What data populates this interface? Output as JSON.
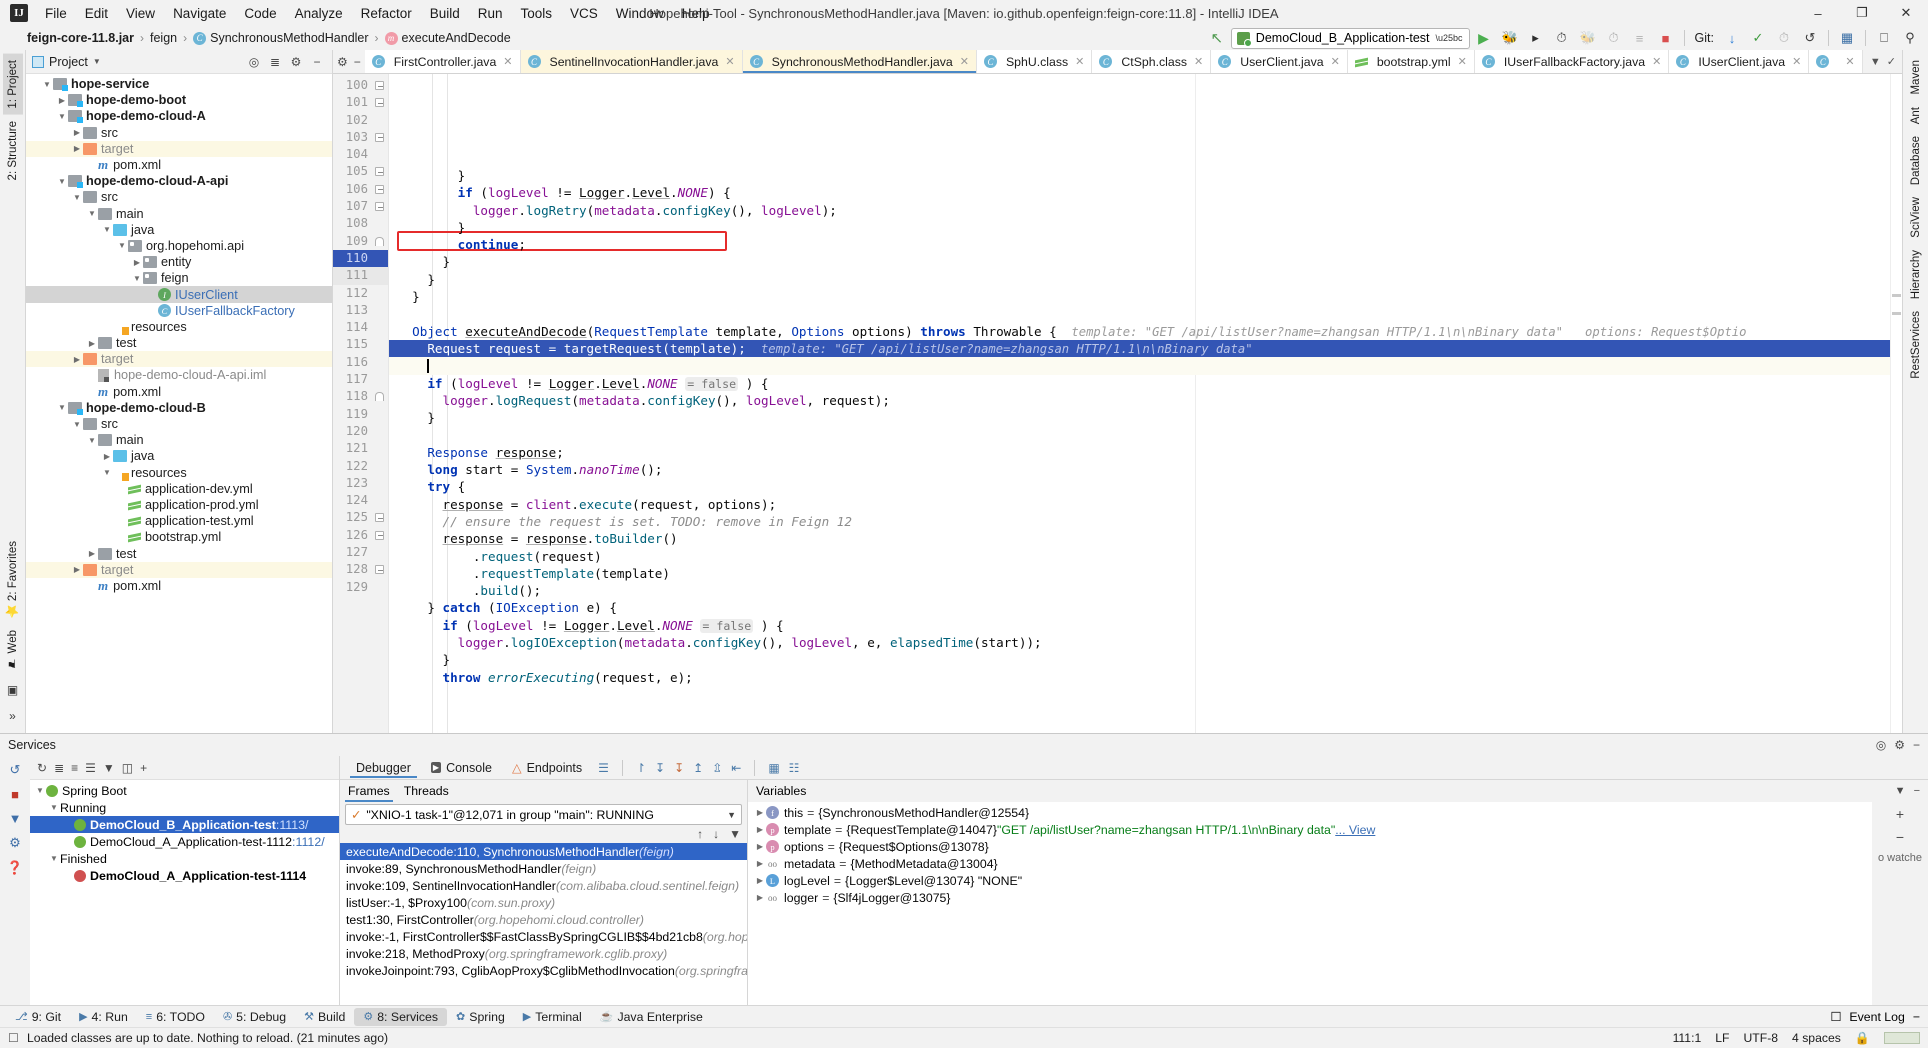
{
  "menubar": {
    "logo": "IJ",
    "items": [
      "File",
      "Edit",
      "View",
      "Navigate",
      "Code",
      "Analyze",
      "Refactor",
      "Build",
      "Run",
      "Tools",
      "VCS",
      "Window",
      "Help"
    ],
    "window_title": "Hopehomi-Tool - SynchronousMethodHandler.java [Maven: io.github.openfeign:feign-core:11.8] - IntelliJ IDEA",
    "minimize": "–",
    "maximize": "❐",
    "close": "✕"
  },
  "navbar": {
    "crumbs": [
      {
        "label": "feign-core-11.8.jar",
        "icon": "",
        "bold": true
      },
      {
        "label": "feign",
        "icon": "",
        "bold": false
      },
      {
        "label": "SynchronousMethodHandler",
        "icon": "c",
        "bold": false
      },
      {
        "label": "executeAndDecode",
        "icon": "m",
        "bold": false
      }
    ],
    "separator": "›",
    "run_config": "DemoCloud_B_Application-test",
    "git_label": "Git:",
    "icons": {
      "back": "↖",
      "run": "▶",
      "debug": "debug-bug-icon",
      "run_coverage": "▷",
      "profiler": "◴",
      "stop": "■",
      "update": "↙",
      "commit": "✓",
      "history": "◷",
      "rollback": "↺",
      "search": "⌕"
    }
  },
  "left_rail": {
    "tabs": [
      "1: Project",
      "2: Structure"
    ],
    "bottom": [
      "⭐ 2: Favorites",
      "⚑ Web",
      "⌨",
      "»"
    ]
  },
  "right_rail": {
    "tabs": [
      "Maven",
      "Ant",
      "Database",
      "SciView",
      "Hierarchy",
      "RestServices"
    ]
  },
  "project_panel": {
    "title": "Project",
    "tree": [
      {
        "indent": 1,
        "tri": "▼",
        "icon": "mod",
        "label": "hope-service",
        "bold": true,
        "hl": ""
      },
      {
        "indent": 2,
        "tri": "▶",
        "icon": "mod",
        "label": "hope-demo-boot",
        "bold": true,
        "hl": ""
      },
      {
        "indent": 2,
        "tri": "▼",
        "icon": "mod",
        "label": "hope-demo-cloud-A",
        "bold": true,
        "hl": ""
      },
      {
        "indent": 3,
        "tri": "▶",
        "icon": "gray",
        "label": "src",
        "bold": false,
        "hl": ""
      },
      {
        "indent": 3,
        "tri": "▶",
        "icon": "orange",
        "label": "target",
        "bold": false,
        "hl": "yellow",
        "muted": true
      },
      {
        "indent": 4,
        "tri": "",
        "icon": "m",
        "label": "pom.xml",
        "bold": false,
        "hl": ""
      },
      {
        "indent": 2,
        "tri": "▼",
        "icon": "mod",
        "label": "hope-demo-cloud-A-api",
        "bold": true,
        "hl": ""
      },
      {
        "indent": 3,
        "tri": "▼",
        "icon": "gray",
        "label": "src",
        "bold": false,
        "hl": ""
      },
      {
        "indent": 4,
        "tri": "▼",
        "icon": "gray",
        "label": "main",
        "bold": false,
        "hl": ""
      },
      {
        "indent": 5,
        "tri": "▼",
        "icon": "blue",
        "label": "java",
        "bold": false,
        "hl": ""
      },
      {
        "indent": 6,
        "tri": "▼",
        "icon": "pkg",
        "label": "org.hopehomi.api",
        "bold": false,
        "hl": ""
      },
      {
        "indent": 7,
        "tri": "▶",
        "icon": "pkg",
        "label": "entity",
        "bold": false,
        "hl": ""
      },
      {
        "indent": 7,
        "tri": "▼",
        "icon": "pkg",
        "label": "feign",
        "bold": false,
        "hl": ""
      },
      {
        "indent": 8,
        "tri": "",
        "icon": "iface",
        "label": "IUserClient",
        "bold": false,
        "hl": "gray",
        "blue": true
      },
      {
        "indent": 8,
        "tri": "",
        "icon": "class",
        "label": "IUserFallbackFactory",
        "bold": false,
        "hl": "",
        "blue": true
      },
      {
        "indent": 5,
        "tri": "",
        "icon": "res",
        "label": "resources",
        "bold": false,
        "hl": ""
      },
      {
        "indent": 4,
        "tri": "▶",
        "icon": "gray",
        "label": "test",
        "bold": false,
        "hl": ""
      },
      {
        "indent": 3,
        "tri": "▶",
        "icon": "orange",
        "label": "target",
        "bold": false,
        "hl": "yellow",
        "muted": true
      },
      {
        "indent": 4,
        "tri": "",
        "icon": "iml",
        "label": "hope-demo-cloud-A-api.iml",
        "bold": false,
        "hl": "",
        "muted": true
      },
      {
        "indent": 4,
        "tri": "",
        "icon": "m",
        "label": "pom.xml",
        "bold": false,
        "hl": ""
      },
      {
        "indent": 2,
        "tri": "▼",
        "icon": "mod",
        "label": "hope-demo-cloud-B",
        "bold": true,
        "hl": ""
      },
      {
        "indent": 3,
        "tri": "▼",
        "icon": "gray",
        "label": "src",
        "bold": false,
        "hl": ""
      },
      {
        "indent": 4,
        "tri": "▼",
        "icon": "gray",
        "label": "main",
        "bold": false,
        "hl": ""
      },
      {
        "indent": 5,
        "tri": "▶",
        "icon": "blue",
        "label": "java",
        "bold": false,
        "hl": ""
      },
      {
        "indent": 5,
        "tri": "▼",
        "icon": "res",
        "label": "resources",
        "bold": false,
        "hl": ""
      },
      {
        "indent": 6,
        "tri": "",
        "icon": "yml",
        "label": "application-dev.yml",
        "bold": false,
        "hl": ""
      },
      {
        "indent": 6,
        "tri": "",
        "icon": "yml",
        "label": "application-prod.yml",
        "bold": false,
        "hl": ""
      },
      {
        "indent": 6,
        "tri": "",
        "icon": "yml",
        "label": "application-test.yml",
        "bold": false,
        "hl": ""
      },
      {
        "indent": 6,
        "tri": "",
        "icon": "yml",
        "label": "bootstrap.yml",
        "bold": false,
        "hl": ""
      },
      {
        "indent": 4,
        "tri": "▶",
        "icon": "gray",
        "label": "test",
        "bold": false,
        "hl": ""
      },
      {
        "indent": 3,
        "tri": "▶",
        "icon": "orange",
        "label": "target",
        "bold": false,
        "hl": "yellow",
        "muted": true
      },
      {
        "indent": 4,
        "tri": "",
        "icon": "m",
        "label": "pom.xml",
        "bold": false,
        "hl": ""
      }
    ]
  },
  "editor": {
    "tabs": [
      {
        "label": "FirstController.java",
        "icon": "c",
        "style": "white"
      },
      {
        "label": "SentinelInvocationHandler.java",
        "icon": "c",
        "style": "yellow"
      },
      {
        "label": "SynchronousMethodHandler.java",
        "icon": "c",
        "style": "active"
      },
      {
        "label": "SphU.class",
        "icon": "c",
        "style": "white"
      },
      {
        "label": "CtSph.class",
        "icon": "c",
        "style": "white"
      },
      {
        "label": "UserClient.java",
        "icon": "c",
        "style": "white"
      },
      {
        "label": "bootstrap.yml",
        "icon": "y",
        "style": "white"
      },
      {
        "label": "IUserFallbackFactory.java",
        "icon": "c",
        "style": "white"
      },
      {
        "label": "IUserClient.java",
        "icon": "c",
        "style": "white"
      },
      {
        "label": "",
        "icon": "c",
        "style": "white"
      }
    ],
    "lines": [
      {
        "n": 100,
        "fold": "box",
        "html": "        }"
      },
      {
        "n": 101,
        "fold": "box",
        "html": "        <span class='kw'>if</span> (<span class='fld'>logLevel</span> != <span class='mtdu'>Logger</span>.<span class='mtdu'>Level</span>.<span class='stat'>NONE</span>) {"
      },
      {
        "n": 102,
        "fold": "",
        "html": "          <span class='fld'>logger</span>.<span class='mtd'>logRetry</span>(<span class='fld'>metadata</span>.<span class='mtd'>configKey</span>(), <span class='fld'>logLevel</span>);"
      },
      {
        "n": 103,
        "fold": "box",
        "html": "        }"
      },
      {
        "n": 104,
        "fold": "",
        "html": "        <span class='kw'>continue</span>;"
      },
      {
        "n": 105,
        "fold": "box",
        "html": "      }"
      },
      {
        "n": 106,
        "fold": "box",
        "html": "    }"
      },
      {
        "n": 107,
        "fold": "box",
        "html": "  }"
      },
      {
        "n": 108,
        "fold": "",
        "html": ""
      },
      {
        "n": 109,
        "fold": "arc",
        "html": "  <span class='kw2'>Object</span> <span class='mtdu'>executeAndDecode</span>(<span class='kw2'>RequestTemplate</span> template, <span class='kw2'>Options</span> options) <span class='kw'>throws</span> Throwable {<span class='hint'>  template: \"GET /api/listUser?name=zhangsan HTTP/1.1\\n\\nBinary data\"   options: Request$Optio</span>"
      },
      {
        "n": 110,
        "fold": "",
        "sel": true,
        "html": "    Request request = targetRequest(template);  <span class='hint'>template: \"GET /api/listUser?name=zhangsan HTTP/1.1\\n\\nBinary data\"</span>"
      },
      {
        "n": 111,
        "fold": "",
        "caret": true,
        "curr": true,
        "html": "    "
      },
      {
        "n": 112,
        "fold": "",
        "html": "    <span class='kw'>if</span> (<span class='fld'>logLevel</span> != <span class='mtdu'>Logger</span>.<span class='mtdu'>Level</span>.<span class='stat'>NONE</span> <span class='inlay'>= false</span> ) {"
      },
      {
        "n": 113,
        "fold": "",
        "html": "      <span class='fld'>logger</span>.<span class='mtd'>logRequest</span>(<span class='fld'>metadata</span>.<span class='mtd'>configKey</span>(), <span class='fld'>logLevel</span>, request);"
      },
      {
        "n": 114,
        "fold": "",
        "html": "    }"
      },
      {
        "n": 115,
        "fold": "",
        "html": ""
      },
      {
        "n": 116,
        "fold": "",
        "html": "    <span class='kw2'>Response</span> <span class='mtdu'>response</span>;"
      },
      {
        "n": 117,
        "fold": "",
        "html": "    <span class='kw'>long</span> start = <span class='kw2'>System</span>.<span class='stat'>nanoTime</span>();"
      },
      {
        "n": 118,
        "fold": "arc",
        "html": "    <span class='kw'>try</span> {"
      },
      {
        "n": 119,
        "fold": "",
        "html": "      <span class='mtdu'>response</span> = <span class='fld'>client</span>.<span class='mtd'>execute</span>(request, options);"
      },
      {
        "n": 120,
        "fold": "",
        "html": "      <span class='cmt'>// ensure the request is set. TODO: remove in Feign 12</span>"
      },
      {
        "n": 121,
        "fold": "",
        "html": "      <span class='mtdu'>response</span> = <span class='mtdu'>response</span>.<span class='mtd'>toBuilder</span>()"
      },
      {
        "n": 122,
        "fold": "",
        "html": "          .<span class='mtd'>request</span>(request)"
      },
      {
        "n": 123,
        "fold": "",
        "html": "          .<span class='mtd'>requestTemplate</span>(template)"
      },
      {
        "n": 124,
        "fold": "",
        "html": "          .<span class='mtd'>build</span>();"
      },
      {
        "n": 125,
        "fold": "box",
        "html": "    } <span class='kw'>catch</span> (<span class='kw2'>IOException</span> e) {"
      },
      {
        "n": 126,
        "fold": "box",
        "html": "      <span class='kw'>if</span> (<span class='fld'>logLevel</span> != <span class='mtdu'>Logger</span>.<span class='mtdu'>Level</span>.<span class='stat'>NONE</span> <span class='inlay'>= false</span> ) {"
      },
      {
        "n": 127,
        "fold": "",
        "html": "        <span class='fld'>logger</span>.<span class='mtd'>logIOException</span>(<span class='fld'>metadata</span>.<span class='mtd'>configKey</span>(), <span class='fld'>logLevel</span>, e, <span class='mtd'>elapsedTime</span>(start));"
      },
      {
        "n": 128,
        "fold": "box",
        "html": "      }"
      },
      {
        "n": 129,
        "fold": "",
        "html": "      <span class='kw'>throw</span> <span class='mtd'><i>errorExecuting</i></span>(request, e);"
      }
    ]
  },
  "services": {
    "title": "Services",
    "tree": [
      {
        "indent": 0,
        "tri": "▼",
        "icon": "spring",
        "label": "Spring Boot",
        "sel": false
      },
      {
        "indent": 1,
        "tri": "▼",
        "icon": "",
        "label": "Running",
        "sel": false
      },
      {
        "indent": 2,
        "tri": "",
        "icon": "green",
        "label": "DemoCloud_B_Application-test",
        "link": ":1113/",
        "sel": true
      },
      {
        "indent": 2,
        "tri": "",
        "icon": "green",
        "label": "DemoCloud_A_Application-test-1112",
        "link": ":1112/",
        "sel": false
      },
      {
        "indent": 1,
        "tri": "▼",
        "icon": "",
        "label": "Finished",
        "sel": false
      },
      {
        "indent": 2,
        "tri": "",
        "icon": "red",
        "label": "DemoCloud_A_Application-test-1114",
        "sel": false
      }
    ]
  },
  "debugger": {
    "tabs": [
      {
        "label": "Debugger",
        "active": true
      },
      {
        "label": "Console",
        "active": false
      },
      {
        "label": "Endpoints",
        "active": false
      }
    ],
    "frames_tabs": [
      {
        "label": "Frames",
        "sel": true
      },
      {
        "label": "Threads",
        "sel": false
      }
    ],
    "thread": "\"XNIO-1 task-1\"@12,071 in group \"main\": RUNNING",
    "frames": [
      {
        "method": "executeAndDecode:110, SynchronousMethodHandler",
        "pkg": "(feign)",
        "sel": true
      },
      {
        "method": "invoke:89, SynchronousMethodHandler",
        "pkg": "(feign)",
        "sel": false
      },
      {
        "method": "invoke:109, SentinelInvocationHandler",
        "pkg": "(com.alibaba.cloud.sentinel.feign)",
        "sel": false
      },
      {
        "method": "listUser:-1, $Proxy100",
        "pkg": "(com.sun.proxy)",
        "sel": false
      },
      {
        "method": "test1:30, FirstController",
        "pkg": "(org.hopehomi.cloud.controller)",
        "sel": false
      },
      {
        "method": "invoke:-1, FirstController$$FastClassBySpringCGLIB$$4bd21cb8",
        "pkg": "(org.hopehomi.cloud",
        "sel": false
      },
      {
        "method": "invoke:218, MethodProxy",
        "pkg": "(org.springframework.cglib.proxy)",
        "sel": false
      },
      {
        "method": "invokeJoinpoint:793, CglibAopProxy$CglibMethodInvocation",
        "pkg": "(org.springframework.a",
        "sel": false
      }
    ],
    "variables_title": "Variables",
    "variables": [
      {
        "tri": "▶",
        "kind": "f",
        "name": "this",
        "eq": "=",
        "value": "{SynchronousMethodHandler@12554}"
      },
      {
        "tri": "▶",
        "kind": "p",
        "name": "template",
        "eq": "=",
        "value": "{RequestTemplate@14047}",
        "str": "\"GET /api/listUser?name=zhangsan HTTP/1.1\\n\\nBinary data\"",
        "more": "... View"
      },
      {
        "tri": "▶",
        "kind": "p",
        "name": "options",
        "eq": "=",
        "value": "{Request$Options@13078}"
      },
      {
        "tri": "▶",
        "kind": "o",
        "name": "metadata",
        "eq": "=",
        "value": "{MethodMetadata@13004}"
      },
      {
        "tri": "▶",
        "kind": "l",
        "name": "logLevel",
        "eq": "=",
        "value": "{Logger$Level@13074} \"NONE\""
      },
      {
        "tri": "▶",
        "kind": "o",
        "name": "logger",
        "eq": "=",
        "value": "{Slf4jLogger@13075}"
      }
    ],
    "watches_label": "o watche"
  },
  "bottom_bar": {
    "items": [
      {
        "icon": "⎇",
        "label": "9: Git",
        "active": false
      },
      {
        "icon": "▶",
        "label": "4: Run",
        "active": false
      },
      {
        "icon": "≡",
        "label": "6: TODO",
        "active": false
      },
      {
        "icon": "✇",
        "label": "5: Debug",
        "active": false
      },
      {
        "icon": "⚒",
        "label": "Build",
        "active": false
      },
      {
        "icon": "⚙",
        "label": "8: Services",
        "active": true
      },
      {
        "icon": "✿",
        "label": "Spring",
        "active": false
      },
      {
        "icon": "▶",
        "label": "Terminal",
        "active": false
      },
      {
        "icon": "☕",
        "label": "Java Enterprise",
        "active": false
      }
    ],
    "right": "Event Log"
  },
  "statusbar": {
    "message": "Loaded classes are up to date. Nothing to reload. (21 minutes ago)",
    "position": "111:1",
    "line_sep": "LF",
    "encoding": "UTF-8",
    "indent": "4 spaces",
    "lock": "🔒"
  }
}
